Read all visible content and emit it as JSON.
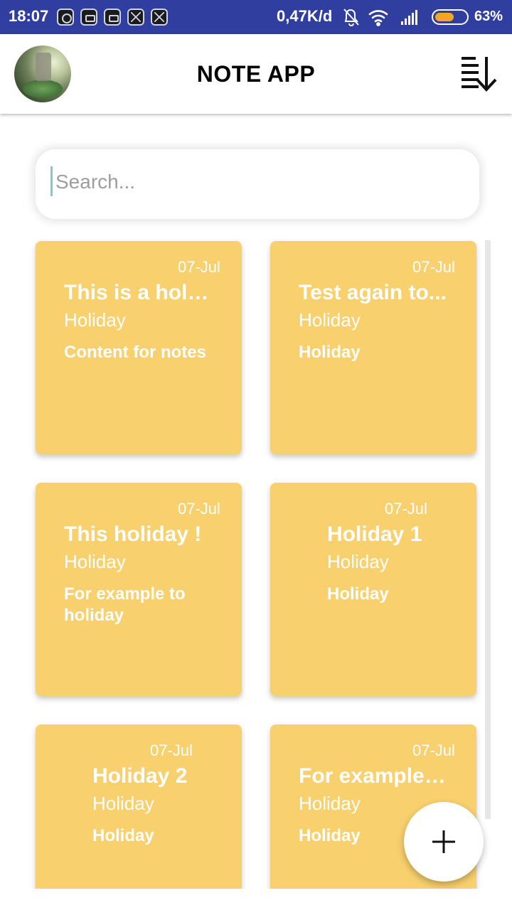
{
  "status_bar": {
    "time": "18:07",
    "network_speed": "0,47K/d",
    "battery_percent": "63%",
    "battery_level": 0.63,
    "notification_icons": [
      "settings-notif-icon",
      "message-notif-icon",
      "calendar-notif-icon",
      "close-notif-icon",
      "close-notif-icon"
    ],
    "right_icons": [
      "mute-bell-icon",
      "wifi-icon",
      "signal-icon",
      "battery-icon"
    ],
    "color": "#303F9F"
  },
  "app_bar": {
    "title": "NOTE APP",
    "avatar_icon": "avatar-image",
    "sort_icon": "sort-descending-icon"
  },
  "search": {
    "placeholder": "Search...",
    "value": ""
  },
  "notes": [
    {
      "date": "07-Jul",
      "title": "This is a holid...",
      "category": "Holiday",
      "content": "Content for notes"
    },
    {
      "date": "07-Jul",
      "title": "Test again to...",
      "category": "Holiday",
      "content": "Holiday"
    },
    {
      "date": "07-Jul",
      "title": "This holiday !",
      "category": "Holiday",
      "content": "For example to holiday"
    },
    {
      "date": "07-Jul",
      "title": "Holiday 1",
      "category": "Holiday",
      "content": "Holiday"
    },
    {
      "date": "07-Jul",
      "title": "Holiday 2",
      "category": "Holiday",
      "content": "Holiday"
    },
    {
      "date": "07-Jul",
      "title": "For example f...",
      "category": "Holiday",
      "content": "Holiday"
    }
  ],
  "fab": {
    "icon": "plus-icon"
  },
  "colors": {
    "note_background": "#F8D06D",
    "accent": "#80CBC4"
  }
}
